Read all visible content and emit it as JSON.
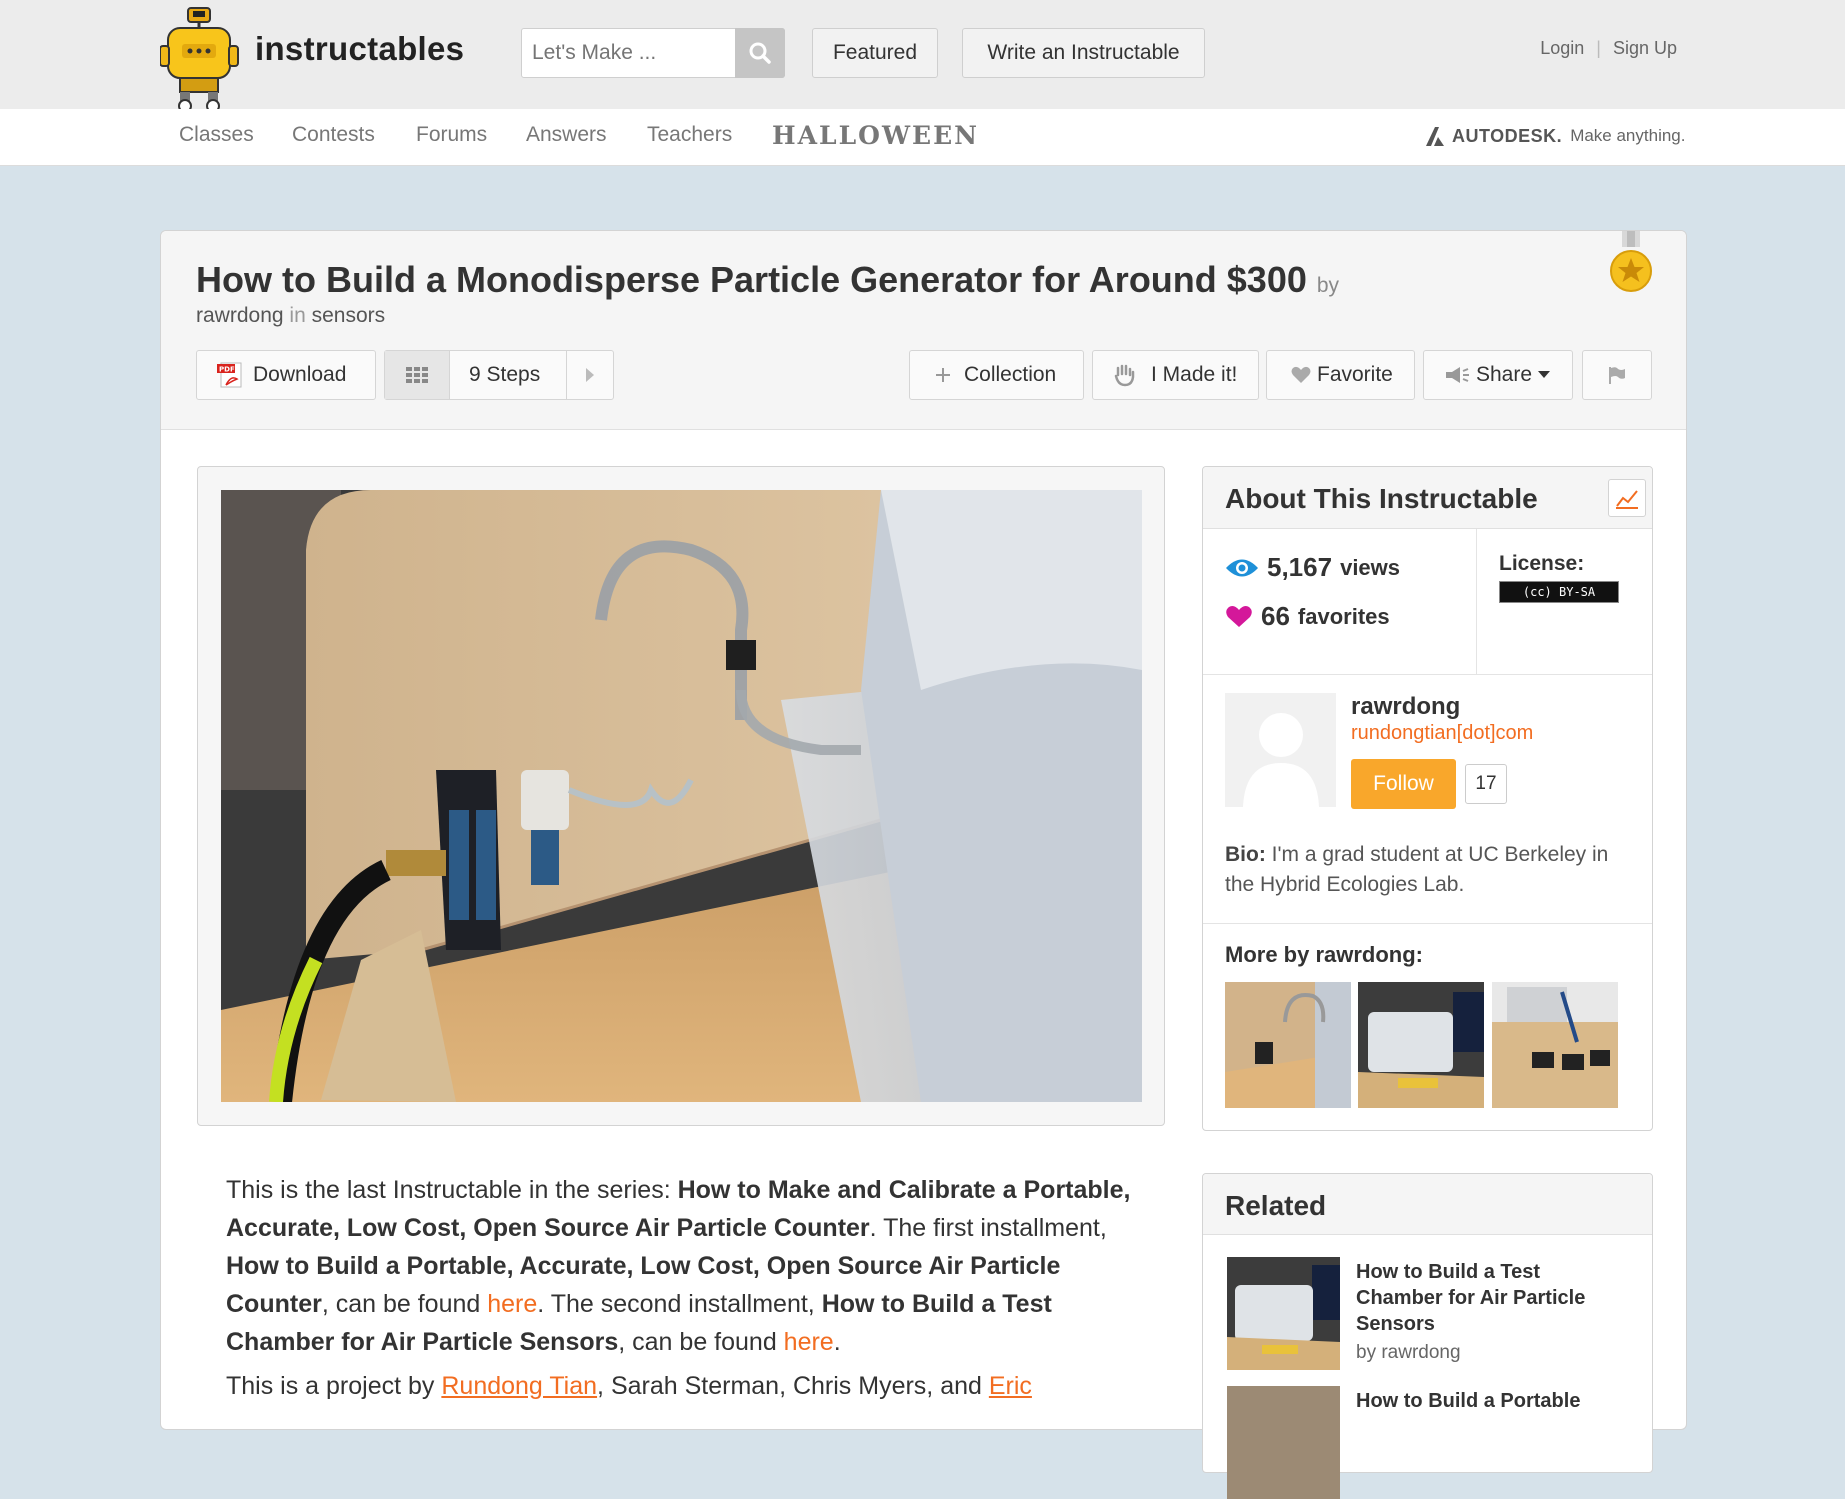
{
  "header": {
    "logo_text": "instructables",
    "search_placeholder": "Let's Make ...",
    "featured_label": "Featured",
    "write_label": "Write an Instructable",
    "login_label": "Login",
    "signup_label": "Sign Up"
  },
  "nav": {
    "items": [
      "Classes",
      "Contests",
      "Forums",
      "Answers",
      "Teachers"
    ],
    "halloween": "HALLOWEEN",
    "autodesk_brand": "AUTODESK.",
    "autodesk_slogan": "Make anything."
  },
  "article": {
    "title": "How to Build a Monodisperse Particle Generator for Around $300",
    "by_label": "by",
    "author": "rawrdong",
    "in_label": "in",
    "category": "sensors"
  },
  "toolbar": {
    "download_label": "Download",
    "pdf_tag": "PDF",
    "steps_label": "9 Steps",
    "collection_label": "Collection",
    "made_it_label": "I Made it!",
    "favorite_label": "Favorite",
    "share_label": "Share"
  },
  "intro": {
    "p1_a": "This is the last Instructable in the series: ",
    "p1_b": "How to Make and Calibrate a Portable, Accurate, Low Cost, Open Source Air Particle Counter",
    "p1_c": ". The first installment, ",
    "p1_d": "How to Build a Portable, Accurate, Low Cost, Open Source Air Particle Counter",
    "p1_e": ", can be found ",
    "p1_link1": "here",
    "p1_f": ". The second installment, ",
    "p1_g": "How to Build a Test Chamber for Air Particle Sensors",
    "p1_h": ", can be found ",
    "p1_link2": "here",
    "p1_i": ".",
    "p2_a": "This is a project by ",
    "p2_link1": "Rundong Tian",
    "p2_b": ", Sarah Sterman, Chris Myers, and ",
    "p2_link2": "Eric"
  },
  "about": {
    "title": "About This Instructable",
    "views_count": "5,167",
    "views_label": "views",
    "favorites_count": "66",
    "favorites_label": "favorites",
    "license_label": "License:",
    "license_badge": "(cc) BY-SA"
  },
  "author_card": {
    "name": "rawrdong",
    "website": "rundongtian[dot]com",
    "follow_label": "Follow",
    "follower_count": "17",
    "bio_label": "Bio:",
    "bio_text": "I'm a grad student at UC Berkeley in the Hybrid Ecologies Lab.",
    "more_by_label": "More by rawrdong:"
  },
  "related": {
    "title": "Related",
    "items": [
      {
        "title": "How to Build a Test Chamber for Air Particle Sensors",
        "by": "by rawrdong"
      },
      {
        "title": "How to Build a Portable",
        "by": ""
      }
    ]
  },
  "colors": {
    "accent_orange": "#f26d21",
    "follow_orange": "#f9a72b",
    "page_bg": "#d6e2ea",
    "favorite_pink": "#d4189a",
    "views_blue": "#1e90d8"
  }
}
